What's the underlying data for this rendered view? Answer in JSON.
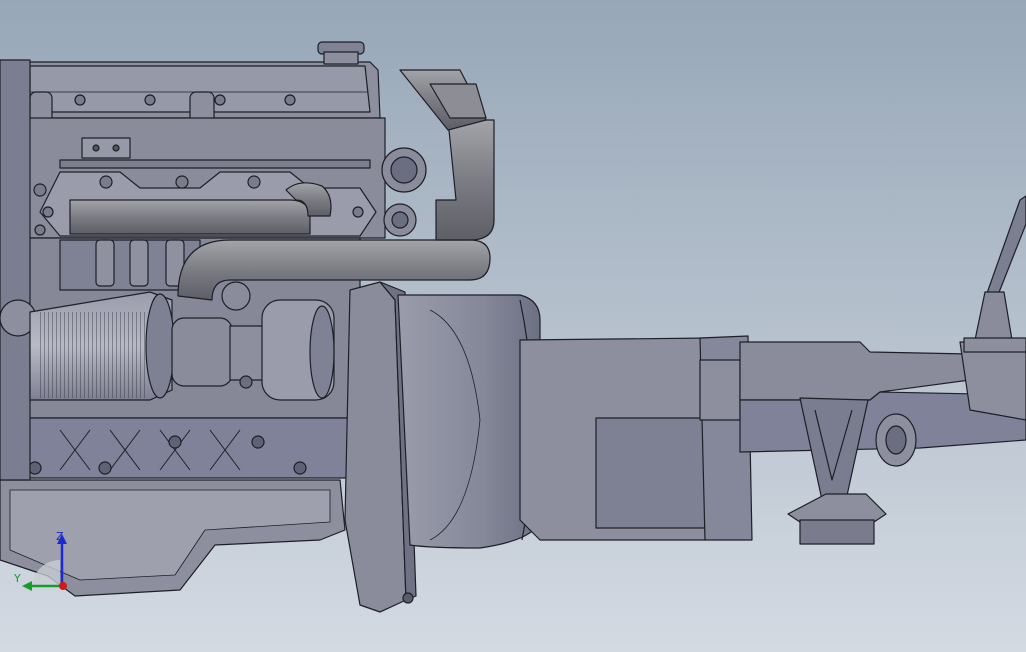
{
  "app": {
    "view": "3d-model-viewport"
  },
  "colors": {
    "background_top": "#97a7b8",
    "background_bottom": "#d4dae2",
    "model_fill": "#8d8f9e",
    "model_shade": "#73768a",
    "model_light": "#a7a9b6",
    "edge": "#1d1f27",
    "axis_y": "#1a9a2a",
    "axis_z": "#1a2ad0",
    "axis_x": "#d01a1a"
  },
  "triad": {
    "z_label": "Z",
    "y_label": "Y",
    "icon": "reference-triad-icon"
  },
  "icons": [
    "engine-model",
    "reference-triad-icon"
  ]
}
